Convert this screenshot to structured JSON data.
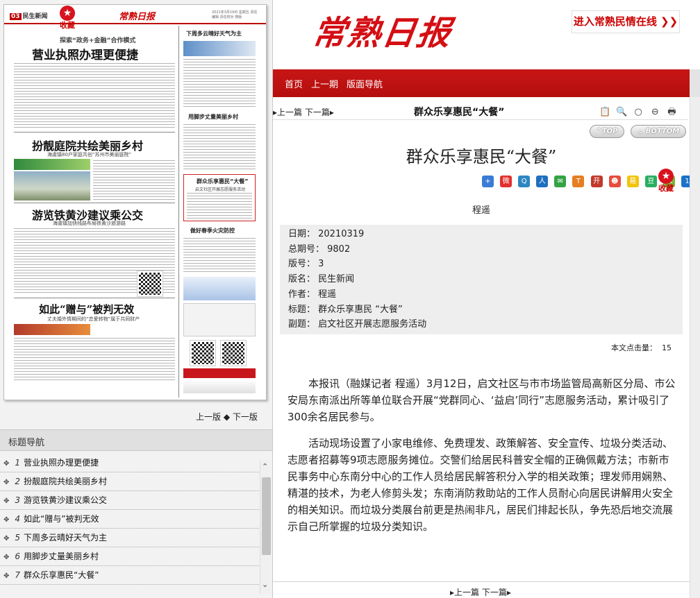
{
  "paper": {
    "page_no": "03",
    "section": "民生新闻",
    "masthead": "常熟日报",
    "date_line": "2021年3月19日 星期五 责任编辑 责任校对 排版",
    "favorite_label": "收藏",
    "kicker": "探索“政务+金融”合作模式",
    "headline1": "营业执照办理更便捷",
    "headline2": "扮靓庭院共绘美丽乡村",
    "sub2": "海虞镇80户家庭共创“苏州市美丽庭院”",
    "headline3": "游览铁黄沙建议乘公交",
    "sub3": "海虞镇加快线路布局铁黄沙旅游路",
    "headline4": "如此“赠与”被判无效",
    "sub4": "丈夫婚外情期间的“恋爱转物”属于共同财产",
    "side1": "下周多云晴好天气为主",
    "side2": "用脚步丈量美丽乡村",
    "side3": "群众乐享惠民“大餐”",
    "side3_sub": "启文社区开展志愿服务活动",
    "side4": "做好春季火灾防控"
  },
  "page_nav": {
    "prev": "上一版",
    "next": "下一版"
  },
  "toc": {
    "header": "标题导航",
    "items": [
      {
        "num": "1",
        "label": "营业执照办理更便捷"
      },
      {
        "num": "2",
        "label": "扮靓庭院共绘美丽乡村"
      },
      {
        "num": "3",
        "label": "游览铁黄沙建议乘公交"
      },
      {
        "num": "4",
        "label": "如此“赠与”被判无效"
      },
      {
        "num": "5",
        "label": "下周多云晴好天气为主"
      },
      {
        "num": "6",
        "label": "用脚步丈量美丽乡村"
      },
      {
        "num": "7",
        "label": "群众乐享惠民“大餐”"
      }
    ]
  },
  "banner": {
    "logo": "常熟日报",
    "enter_link": "进入常熟民情在线 ❯❯",
    "brand_color": "#d40f14"
  },
  "nav": {
    "home": "首页",
    "prev_issue": "上一期",
    "layout_nav": "版面导航"
  },
  "article": {
    "prev": "上一篇",
    "next": "下一篇",
    "bar_title": "群众乐享惠民“大餐”",
    "title": "群众乐享惠民“大餐”",
    "author": "程遥",
    "favorite_label": "收藏",
    "top_label": "TOP",
    "bottom_label": "BOTTOM",
    "meta": {
      "date": "日期： 20210319",
      "issue": "总期号： 9802",
      "page": "版号： 3",
      "section": "版名： 民生新闻",
      "author": "作者： 程遥",
      "title": "标题： 群众乐享惠民 “大餐”",
      "subtitle": "副题： 启文社区开展志愿服务活动"
    },
    "click_label": "本文点击量：",
    "click_count": "15",
    "paragraphs": [
      "本报讯（融媒记者 程遥）3月12日，启文社区与市市场监管局高新区分局、市公安局东南派出所等单位联合开展“党群同心、‘益启’同行”志愿服务活动，累计吸引了300余名居民参与。",
      "活动现场设置了小家电维修、免费理发、政策解答、安全宣传、垃圾分类活动、志愿者招募等9项志愿服务摊位。交警们给居民科普安全帽的正确佩戴方法；市新市民事务中心东南分中心的工作人员给居民解答积分入学的相关政策；理发师用娴熟、精湛的技术，为老人修剪头发；东南消防救助站的工作人员耐心向居民讲解用火安全的相关知识。而垃圾分类展台前更是热闹非凡，居民们排起长队，争先恐后地交流展示自己所掌握的垃圾分类知识。"
    ]
  }
}
